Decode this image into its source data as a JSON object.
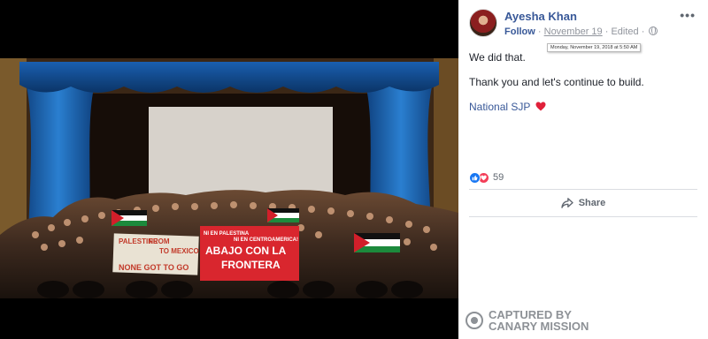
{
  "post": {
    "author": "Ayesha Khan",
    "follow": "Follow",
    "separator1": "·",
    "date": "November 19",
    "separator2": "·",
    "edited": "Edited",
    "separator3": "·",
    "tooltip": "Monday, November 19, 2018 at 5:50 AM",
    "more": "•••",
    "text_lines": [
      "We did that.",
      "Thank you and let's continue to build.",
      "National SJP"
    ],
    "reaction_count": "59",
    "share_label": "Share"
  },
  "photo": {
    "banner_left": [
      "PALESTINE",
      "FROM",
      "TO MEXICO",
      "NONE GOT TO GO"
    ],
    "banner_right": [
      "NI EN PALESTINA",
      "NI EN CENTROAMERICA!",
      "ABAJO CON LA",
      "FRONTERA"
    ]
  },
  "watermark": {
    "line1": "CAPTURED BY",
    "line2": "CANARY MISSION"
  },
  "colors": {
    "link": "#385898",
    "text": "#1d2129",
    "muted": "#90949c",
    "heart": "#f33e58",
    "like": "#1877f2"
  }
}
